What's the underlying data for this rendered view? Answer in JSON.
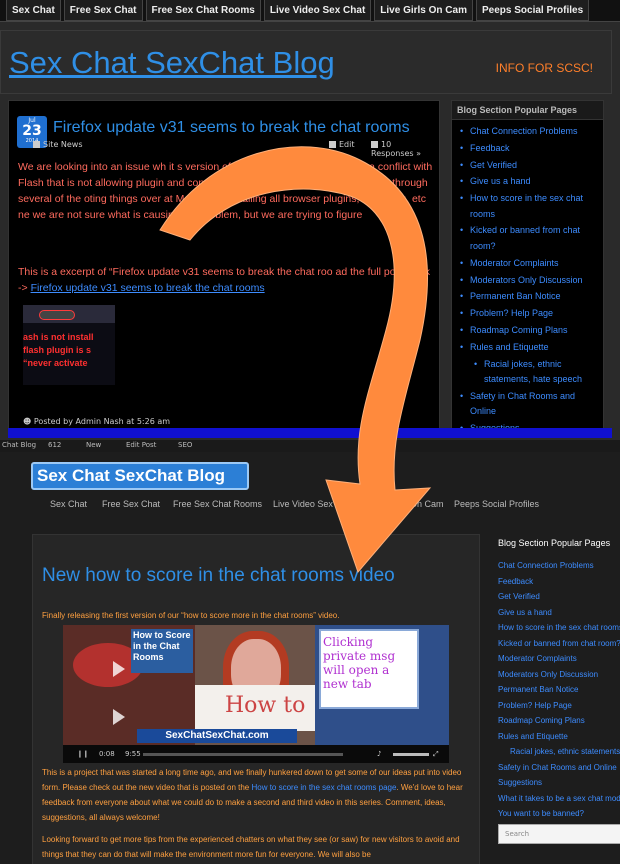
{
  "old_site": {
    "nav": [
      "Sex Chat",
      "Free Sex Chat",
      "Free Sex Chat Rooms",
      "Live Video Sex Chat",
      "Live Girls On Cam",
      "Peeps Social Profiles"
    ],
    "title": "Sex Chat SexChat Blog",
    "info_link": "INFO FOR SCSC!",
    "post": {
      "date_month": "Jul",
      "date_day": "23",
      "date_year": "2014",
      "title": "Firefox update v31 seems to break the chat rooms",
      "category": "Site News",
      "edit": "Edit",
      "responses": "10 Responses »",
      "para1": "We are looking into an issue wh    it s               version of firefox, version 31 is causing a conflict with Flash that is not allowing        plugin and connect with the OC chat rooms. I have run through several of the         oting things over at Mozilla; uninstalling all browser plugins, restarting, etc       ne we are not sure what is causing the problem, but we are trying to figure",
      "para2_prefix": "This is a excerpt of “Firefox update v31 seems to break the chat roo        ad the full post, click ->",
      "para2_link": "Firefox update v31 seems to break the chat rooms",
      "thumb_lines": [
        "ash is not install",
        "flash plugin is s",
        "“never activate"
      ],
      "posted_by": "Posted by Admin Nash at 5:26 am"
    },
    "sidebar": {
      "heading": "Blog Section Popular Pages",
      "items": [
        {
          "label": "Chat Connection Problems",
          "sub": false
        },
        {
          "label": "Feedback",
          "sub": false
        },
        {
          "label": "Get Verified",
          "sub": false
        },
        {
          "label": "Give us a hand",
          "sub": false
        },
        {
          "label": "How to score in the sex chat rooms",
          "sub": false
        },
        {
          "label": "Kicked or banned from chat room?",
          "sub": false
        },
        {
          "label": "Moderator Complaints",
          "sub": false
        },
        {
          "label": "Moderators Only Discussion",
          "sub": false
        },
        {
          "label": "Permanent Ban Notice",
          "sub": false
        },
        {
          "label": "Problem? Help Page",
          "sub": false
        },
        {
          "label": "Roadmap Coming Plans",
          "sub": false
        },
        {
          "label": "Rules and Etiquette",
          "sub": false
        },
        {
          "label": "Racial jokes, ethnic statements, hate speech",
          "sub": true
        },
        {
          "label": "Safety in Chat Rooms and Online",
          "sub": false
        },
        {
          "label": "Suggestions",
          "sub": false
        }
      ]
    }
  },
  "new_site": {
    "adminbar": [
      "Chat Blog",
      "612",
      "New",
      "Edit Post",
      "SEO"
    ],
    "logo": "Sex Chat SexChat Blog",
    "nav": [
      "Sex Chat",
      "Free Sex Chat",
      "Free Sex Chat Rooms",
      "Live Video Sex Chat",
      "Live Girls On Cam",
      "Peeps Social Profiles"
    ],
    "post": {
      "title": "New how to score in the chat rooms video",
      "intro": "Finally releasing the first version of our “how to score more in the chat rooms” video.",
      "video": {
        "htsc": "How to Score in the Chat Rooms",
        "sign": "How to",
        "popup": "Clicking private msg will open a new tab",
        "url": "SexChatSexChat.com",
        "time_current": "0:08",
        "time_total": "9:55"
      },
      "para1_a": "This is a project that was started a long time ago, and we finally hunkered down to get some of our ideas put into video form. Please check out the new video that is posted on the",
      "para1_link": "How to score in the sex chat rooms page",
      "para1_b": ". We'd love to hear feedback from everyone about what we could do to make a second and third video in this series. Comment, ideas, suggestions, all always welcome!",
      "para2": "Looking forward to get more tips from the experienced chatters on what they see (or saw) for new visitors to avoid and things that they can do that will make the environment more fun for everyone. We will also be"
    },
    "sidebar": {
      "heading": "Blog Section Popular Pages",
      "items": [
        {
          "label": "Chat Connection Problems",
          "sub": false
        },
        {
          "label": "Feedback",
          "sub": false
        },
        {
          "label": "Get Verified",
          "sub": false
        },
        {
          "label": "Give us a hand",
          "sub": false
        },
        {
          "label": "How to score in the sex chat rooms",
          "sub": false
        },
        {
          "label": "Kicked or banned from chat room?",
          "sub": false
        },
        {
          "label": "Moderator Complaints",
          "sub": false
        },
        {
          "label": "Moderators Only Discussion",
          "sub": false
        },
        {
          "label": "Permanent Ban Notice",
          "sub": false
        },
        {
          "label": "Problem? Help Page",
          "sub": false
        },
        {
          "label": "Roadmap Coming Plans",
          "sub": false
        },
        {
          "label": "Rules and Etiquette",
          "sub": false
        },
        {
          "label": "Racial jokes, ethnic statements, hate speech",
          "sub": true
        },
        {
          "label": "Safety in Chat Rooms and Online",
          "sub": false
        },
        {
          "label": "Suggestions",
          "sub": false
        },
        {
          "label": "What it takes to be a sex chat mod",
          "sub": false
        },
        {
          "label": "You want to be banned?",
          "sub": false
        }
      ],
      "search_placeholder": "Search"
    }
  },
  "colors": {
    "link_blue": "#2f8fe6",
    "orange_text": "#ffa040",
    "red_text": "#ff6b5e",
    "arrow": "#ff8a3d"
  }
}
